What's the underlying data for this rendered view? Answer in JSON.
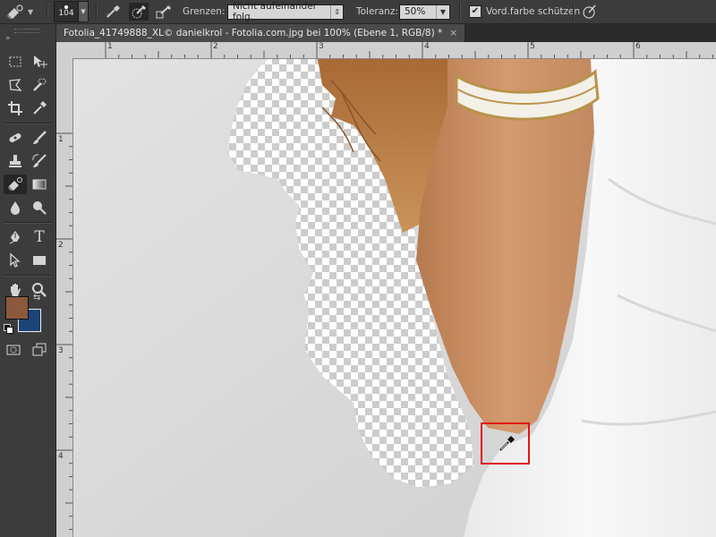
{
  "options_bar": {
    "brush_size": "104",
    "boundaries_label": "Grenzen:",
    "boundaries_value": "Nicht aufeinander folg.",
    "tolerance_label": "Toleranz:",
    "tolerance_value": "50%",
    "protect_foreground_label": "Vord.farbe schützen",
    "protect_foreground_checked": true
  },
  "document": {
    "tab_title": "Fotolia_41749888_XL© danielkrol - Fotolia.com.jpg bei 100% (Ebene 1, RGB/8) *",
    "close_symbol": "×"
  },
  "rulers": {
    "horizontal_labels": [
      "1",
      "2",
      "3",
      "4",
      "5",
      "6"
    ],
    "vertical_labels": [
      "1",
      "2",
      "3",
      "4"
    ]
  },
  "colors": {
    "foreground": "#8b5a3c",
    "background": "#1d4477",
    "selection_box": "#e01414",
    "canvas_gray": "#d9d9da"
  },
  "toolbar": {
    "tools": [
      "move",
      "marquee",
      "lasso",
      "quick-selection",
      "crop",
      "eyedropper",
      "spot-healing",
      "brush",
      "clone-stamp",
      "history-brush",
      "background-eraser",
      "gradient",
      "blur",
      "dodge",
      "pen",
      "type",
      "path-selection",
      "rectangle",
      "hand",
      "zoom"
    ]
  }
}
